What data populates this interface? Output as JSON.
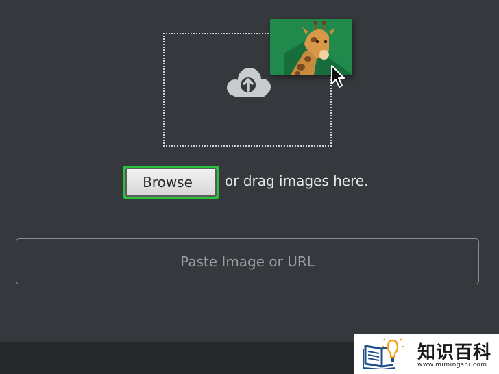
{
  "upload": {
    "cloud_icon": "cloud-upload-icon",
    "dragged_image_icon": "giraffe-image-icon",
    "cursor_icon": "arrow-cursor-icon"
  },
  "actions": {
    "browse_label": "Browse",
    "drag_text": "or drag images here."
  },
  "url_input": {
    "placeholder": "Paste Image or URL",
    "value": ""
  },
  "watermark": {
    "name": "知识百科",
    "url": "www.mimingshi.com",
    "logo_icon": "book-lightbulb-icon"
  },
  "colors": {
    "background": "#35383c",
    "highlight": "#28c23b",
    "thumbnail": "#1f8a4c"
  }
}
